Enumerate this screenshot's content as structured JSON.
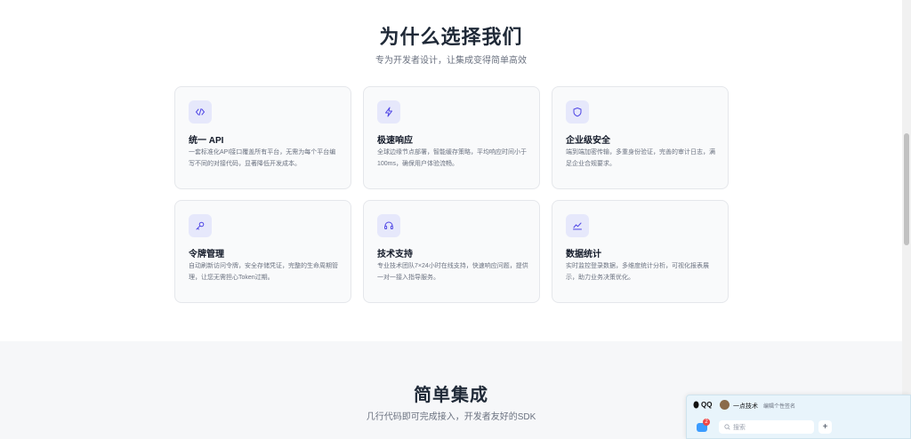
{
  "why": {
    "title": "为什么选择我们",
    "subtitle": "专为开发者设计，让集成变得简单高效",
    "cards": [
      {
        "icon": "code-icon",
        "title": "统一 API",
        "desc": "一套标准化API接口覆盖所有平台，无需为每个平台编写不同的对接代码，显著降低开发成本。"
      },
      {
        "icon": "lightning-icon",
        "title": "极速响应",
        "desc": "全球边缘节点部署，智能缓存策略，平均响应时间小于100ms，确保用户体验流畅。"
      },
      {
        "icon": "shield-icon",
        "title": "企业级安全",
        "desc": "端到端加密传输，多重身份验证，完善的审计日志，满足企业合规要求。"
      },
      {
        "icon": "key-icon",
        "title": "令牌管理",
        "desc": "自动刷新访问令牌，安全存储凭证，完整的生命周期管理，让您无需担心Token过期。"
      },
      {
        "icon": "headset-icon",
        "title": "技术支持",
        "desc": "专业技术团队7×24小时在线支持，快速响应问题，提供一对一接入指导服务。"
      },
      {
        "icon": "chart-icon",
        "title": "数据统计",
        "desc": "实时监控登录数据，多维度统计分析，可视化报表展示，助力业务决策优化。"
      }
    ]
  },
  "sdk": {
    "title": "简单集成",
    "subtitle": "几行代码即可完成接入，开发者友好的SDK"
  },
  "qq": {
    "brand": "QQ",
    "name": "一点技术",
    "signature": "编辑个性签名",
    "badge": "2",
    "search_placeholder": "搜索",
    "plus": "+"
  }
}
